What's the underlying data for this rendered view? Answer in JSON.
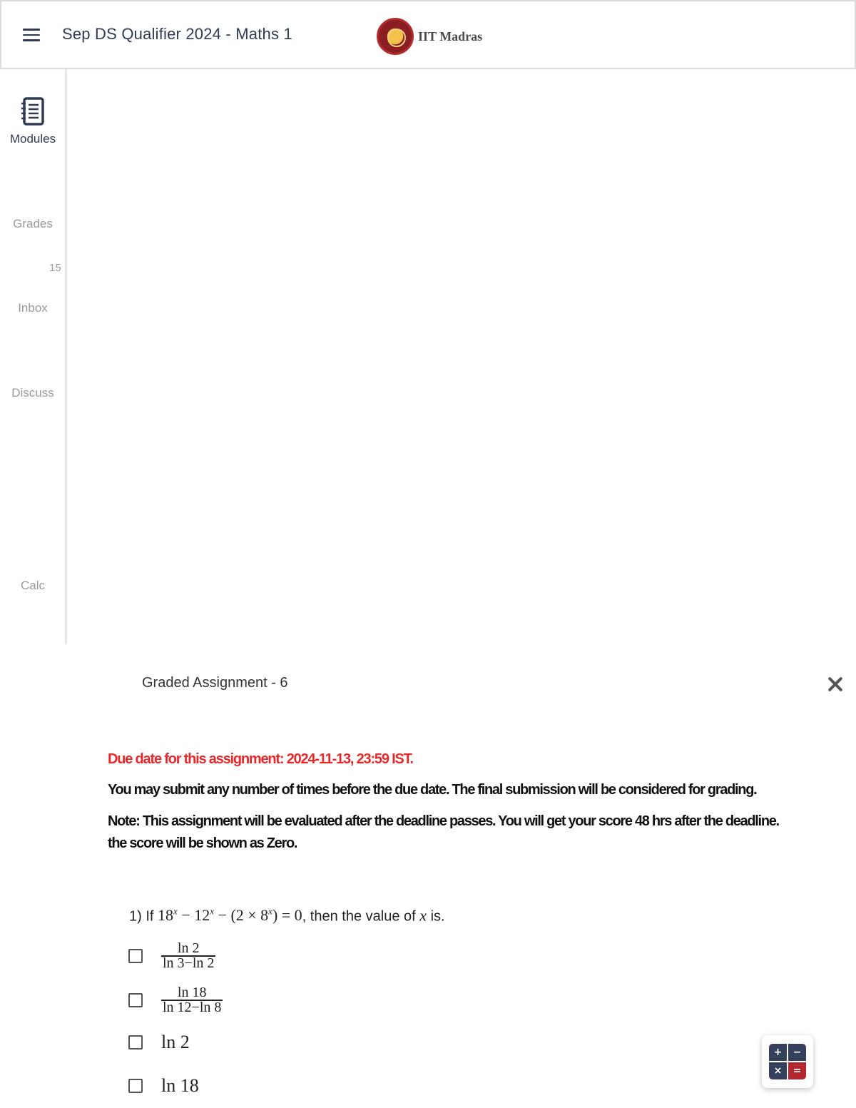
{
  "header": {
    "title": "Sep DS Qualifier 2024 - Maths 1",
    "logo_text": "IIT Madras",
    "menu_icon": "hamburger-menu-icon"
  },
  "sidebar": {
    "items": [
      {
        "label": "Modules",
        "icon": "notebook-icon",
        "active": true
      },
      {
        "label": "Grades",
        "active": false
      },
      {
        "label": "Inbox",
        "badge": "15",
        "active": false
      },
      {
        "label": "Discuss",
        "active": false
      },
      {
        "label": "Calc",
        "active": false
      }
    ]
  },
  "panel": {
    "title": "Graded Assignment - 6",
    "close_icon": "close-icon"
  },
  "notices": {
    "due": "Due date for this assignment: 2024-11-13, 23:59 IST.",
    "submit": "You may submit any number of times before the due date. The final submission will be considered for grading.",
    "note_line1": "Note: This assignment will be evaluated after the deadline passes. You will get your score 48 hrs after the deadline.",
    "note_line2": "the score will be shown as Zero."
  },
  "question": {
    "number": "1)",
    "prefix": "If",
    "equation": "18^x − 12^x − (2 × 8^x) = 0",
    "middle": ", then the value of",
    "variable": "x",
    "suffix": "is.",
    "options": [
      {
        "type": "fraction",
        "numerator": "ln 2",
        "denominator": "ln 3−ln 2"
      },
      {
        "type": "fraction",
        "numerator": "ln 18",
        "denominator": "ln 12−ln 8"
      },
      {
        "type": "text",
        "value": "ln 2"
      },
      {
        "type": "text",
        "value": "ln 18"
      }
    ]
  },
  "calculator": {
    "icon": "calculator-icon",
    "keys": [
      "+",
      "−",
      "×",
      "="
    ]
  },
  "colors": {
    "primary": "#2f3a55",
    "due_red": "#e8292c",
    "muted": "#9a9a9a",
    "calc_red": "#b3262d"
  }
}
